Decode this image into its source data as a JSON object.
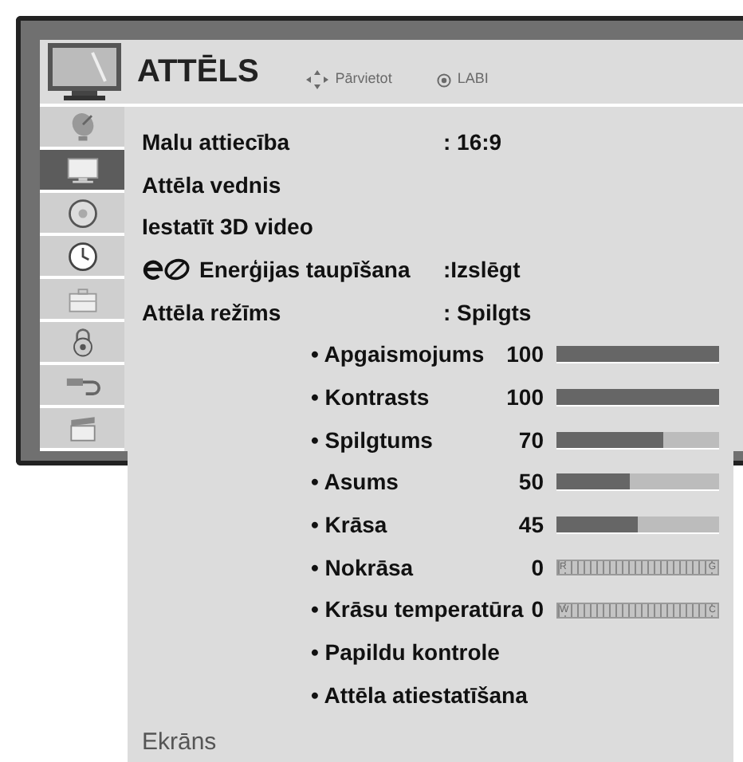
{
  "header": {
    "title": "ATTĒLS",
    "hints": [
      {
        "kind": "move",
        "label": "Pārvietot"
      },
      {
        "kind": "ok",
        "label": "LABI"
      }
    ]
  },
  "sidebar": {
    "items": [
      {
        "kind": "dish",
        "selected": false
      },
      {
        "kind": "tv",
        "selected": true
      },
      {
        "kind": "disc",
        "selected": false
      },
      {
        "kind": "clock",
        "selected": false
      },
      {
        "kind": "toolbox",
        "selected": false
      },
      {
        "kind": "lock",
        "selected": false
      },
      {
        "kind": "cable",
        "selected": false
      },
      {
        "kind": "clapboard",
        "selected": false
      }
    ]
  },
  "menu": {
    "rows": [
      {
        "kind": "setting",
        "label": "Malu attiecība",
        "value": ": 16:9"
      },
      {
        "kind": "setting",
        "label": "Attēla vednis"
      },
      {
        "kind": "setting",
        "label": "Iestatīt 3D video"
      },
      {
        "kind": "eco",
        "label": "Enerģijas taupīšana",
        "value": ":Izslēgt"
      },
      {
        "kind": "setting",
        "label": "Attēla režīms",
        "value": ": Spilgts"
      },
      {
        "kind": "slider",
        "label": "• Apgaismojums",
        "value": "100",
        "level": 1
      },
      {
        "kind": "slider",
        "label": "• Kontrasts",
        "value": "100",
        "level": 1
      },
      {
        "kind": "slider",
        "label": "• Spilgtums",
        "value": "70",
        "level": 0.66
      },
      {
        "kind": "slider",
        "label": "• Asums",
        "value": "50",
        "level": 0.45
      },
      {
        "kind": "slider",
        "label": "• Krāsa",
        "value": "45",
        "level": 0.5
      },
      {
        "kind": "balance",
        "label": "• Nokrāsa",
        "value": "0",
        "left": "R",
        "right": "G"
      },
      {
        "kind": "balance",
        "label": "• Krāsu temperatūra",
        "value": "0",
        "left": "W",
        "right": "C"
      },
      {
        "kind": "action",
        "label": "• Papildu kontrole"
      },
      {
        "kind": "action",
        "label": "• Attēla atiestatīšana"
      }
    ],
    "footer": "Ekrāns"
  }
}
